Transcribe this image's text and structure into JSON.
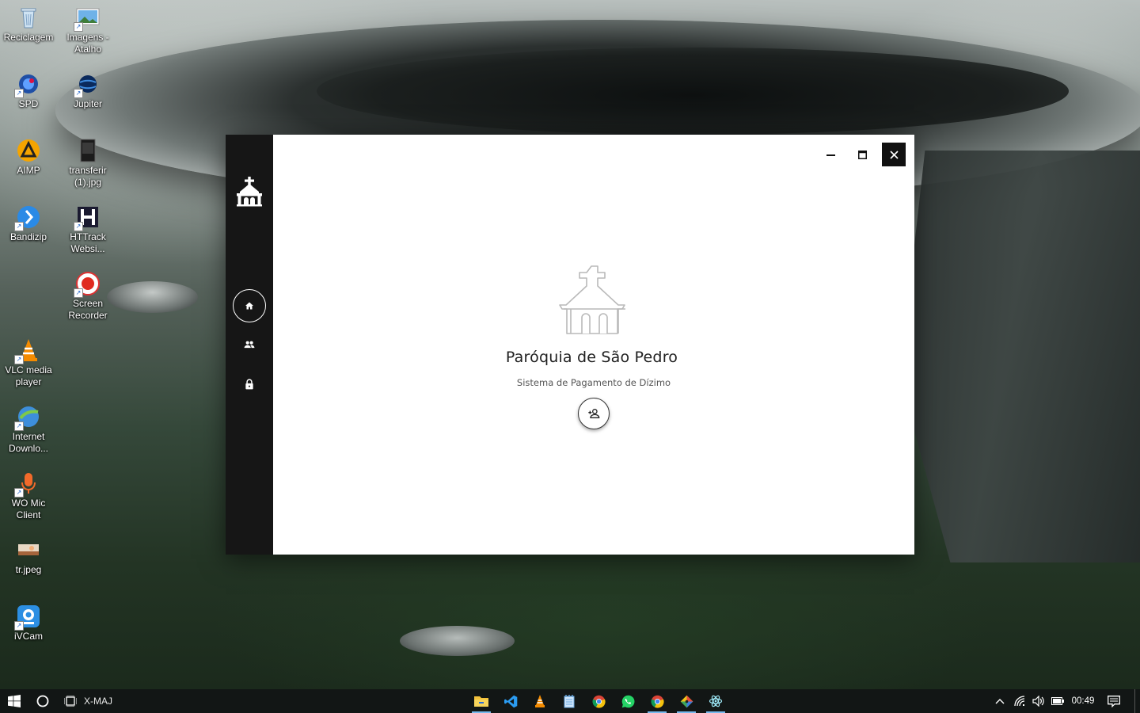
{
  "desktop": {
    "icons": [
      {
        "label": "Reciclagem",
        "icon": "recycle-bin-icon"
      },
      {
        "label": "Imagens - Atalho",
        "icon": "images-shortcut-icon"
      },
      {
        "label": "SPD",
        "icon": "spd-icon"
      },
      {
        "label": "Jupiter",
        "icon": "jupiter-icon"
      },
      {
        "label": "AIMP",
        "icon": "aimp-icon"
      },
      {
        "label": "transferir (1).jpg",
        "icon": "jpg-file-icon"
      },
      {
        "label": "Bandizip",
        "icon": "bandizip-icon"
      },
      {
        "label": "HTTrack Websi...",
        "icon": "httrack-icon"
      },
      {
        "label": "Screen Recorder",
        "icon": "screen-recorder-icon"
      },
      {
        "label": "VLC media player",
        "icon": "vlc-icon"
      },
      {
        "label": "Internet Downlo...",
        "icon": "internet-download-manager-icon"
      },
      {
        "label": "WO Mic Client",
        "icon": "wo-mic-icon"
      },
      {
        "label": "tr.jpeg",
        "icon": "jpeg-file-icon"
      },
      {
        "label": "iVCam",
        "icon": "ivcam-icon"
      }
    ]
  },
  "app": {
    "title": "Paróquia de São Pedro",
    "subtitle": "Sistema de Pagamento de Dízimo",
    "sidebar": {
      "logo_icon": "church-icon",
      "items": [
        {
          "icon": "home-icon",
          "active": true
        },
        {
          "icon": "people-icon",
          "active": false
        },
        {
          "icon": "lock-icon",
          "active": false
        }
      ]
    },
    "hero_icon": "church-icon",
    "action_icon": "add-person-icon",
    "window_controls": [
      "minimize-icon",
      "maximize-icon",
      "close-icon"
    ]
  },
  "taskbar": {
    "search_label": "X-MAJ",
    "apps": [
      {
        "icon": "file-explorer-icon",
        "running": true
      },
      {
        "icon": "vscode-icon",
        "running": false
      },
      {
        "icon": "vlc-icon",
        "running": false
      },
      {
        "icon": "notepad-icon",
        "running": false
      },
      {
        "icon": "chrome-icon",
        "running": false
      },
      {
        "icon": "whatsapp-icon",
        "running": false
      },
      {
        "icon": "chrome-icon",
        "running": true
      },
      {
        "icon": "git-icon",
        "running": true
      },
      {
        "icon": "electron-icon",
        "running": true
      }
    ],
    "clock": "00:49"
  },
  "colors": {
    "sidebar_bg": "#161616",
    "taskbar_bg": "#121615",
    "accent": "#76b9ed"
  }
}
